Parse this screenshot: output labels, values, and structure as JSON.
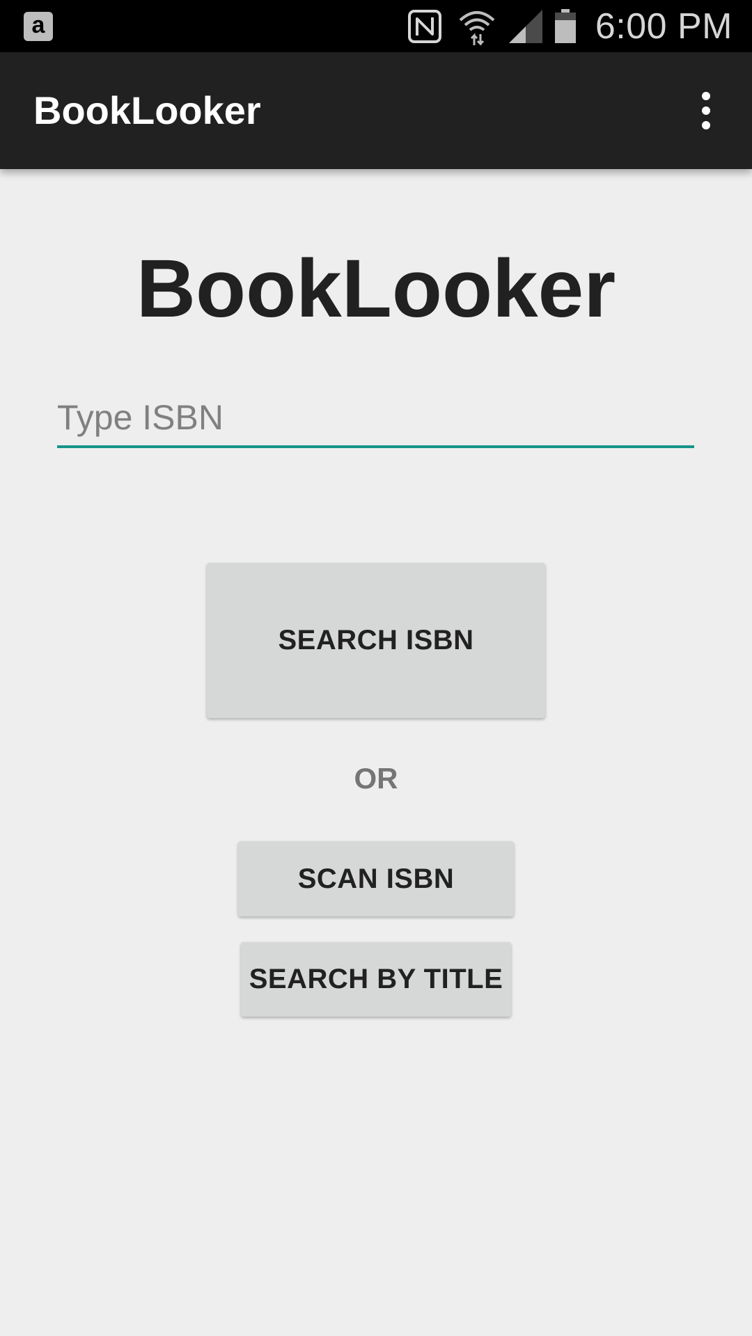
{
  "status_bar": {
    "time": "6:00 PM",
    "left_icon": "amazon-icon",
    "left_icon_glyph": "a",
    "icons": [
      "nfc-icon",
      "wifi-icon",
      "signal-icon",
      "battery-icon"
    ]
  },
  "app_bar": {
    "title": "BookLooker",
    "menu_icon": "overflow-menu-icon"
  },
  "main": {
    "heading": "BookLooker",
    "isbn_placeholder": "Type ISBN",
    "search_isbn_label": "SEARCH ISBN",
    "or_label": "OR",
    "scan_isbn_label": "SCAN ISBN",
    "search_title_label": "SEARCH BY TITLE"
  },
  "colors": {
    "status_bar_bg": "#000000",
    "app_bar_bg": "#212121",
    "page_bg": "#eeeeee",
    "accent": "#159588",
    "button_bg": "#d6d7d7"
  }
}
